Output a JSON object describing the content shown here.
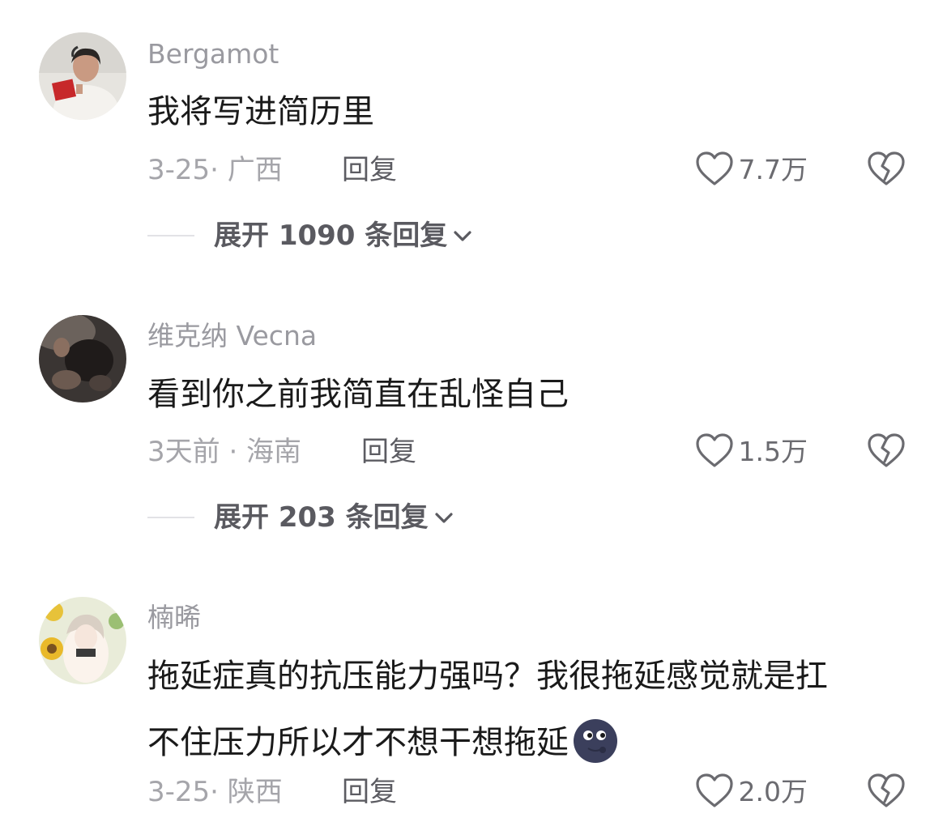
{
  "comments": [
    {
      "username": "Bergamot",
      "avatar_icon": "avatar-woman-reading-red-book",
      "lines": [
        "我将写进简历里"
      ],
      "meta": "3-25· 广西",
      "reply_label": "回复",
      "likes": "7.7万",
      "expand_label": "展开 1090 条回复"
    },
    {
      "username": "维克纳 Vecna",
      "avatar_icon": "avatar-dark-photo",
      "lines": [
        "看到你之前我简直在乱怪自己"
      ],
      "meta": "3天前 · 海南",
      "reply_label": "回复",
      "likes": "1.5万",
      "expand_label": "展开 203 条回复"
    },
    {
      "username": "楠晞",
      "avatar_icon": "avatar-anime-girl-sunflowers",
      "lines": [
        "拖延症真的抗压能力强吗？我很拖延感觉就是扛",
        "不住压力所以才不想干想拖延"
      ],
      "trailing_emoji": "new-moon-face-emoji",
      "meta": "3-25· 陕西",
      "reply_label": "回复",
      "likes": "2.0万"
    }
  ],
  "icons": {
    "like": "heart-outline-icon",
    "dislike": "broken-heart-icon",
    "expand": "chevron-down-icon"
  },
  "colors": {
    "username": "#9a9aa0",
    "content": "#1a1a1a",
    "meta": "#a5a5aa",
    "action": "#5c5c62"
  }
}
